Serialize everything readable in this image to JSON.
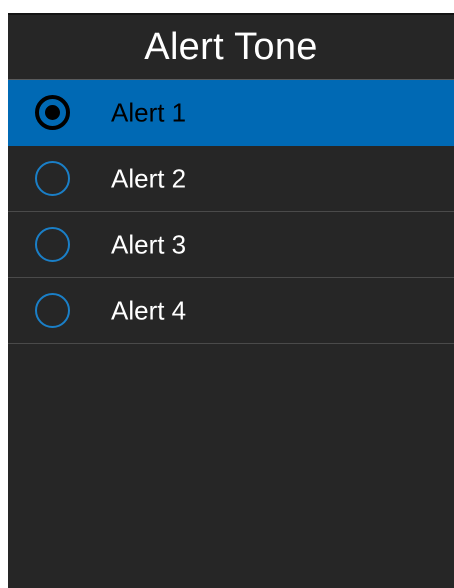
{
  "screen": {
    "title": "Alert Tone"
  },
  "options": [
    {
      "label": "Alert 1",
      "selected": true
    },
    {
      "label": "Alert 2",
      "selected": false
    },
    {
      "label": "Alert 3",
      "selected": false
    },
    {
      "label": "Alert 4",
      "selected": false
    }
  ],
  "colors": {
    "background": "#262626",
    "selection": "#0069b4",
    "radio_ring": "#1a7fc7",
    "text": "#ffffff",
    "selected_text": "#000000"
  },
  "icons": {
    "selected": "radio-checked-icon",
    "unselected": "radio-unchecked-icon"
  }
}
